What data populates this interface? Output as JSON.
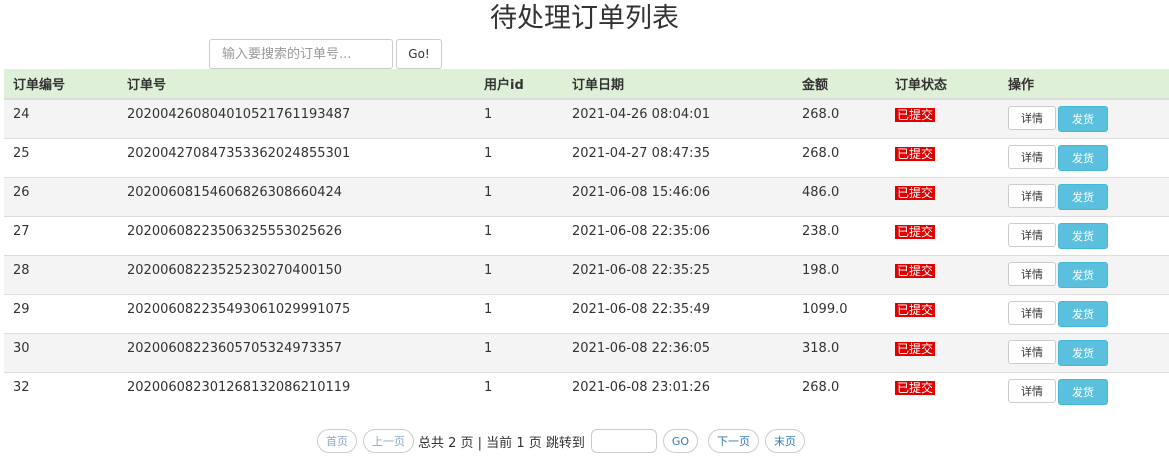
{
  "title": "待处理订单列表",
  "search": {
    "placeholder": "输入要搜索的订单号...",
    "button_label": "Go!"
  },
  "table": {
    "headers": [
      "订单编号",
      "订单号",
      "用户id",
      "订单日期",
      "金额",
      "订单状态",
      "操作"
    ],
    "rows": [
      {
        "id": "24",
        "order_no": "20200426080401052176119348​7",
        "user_id": "1",
        "date": "2021-04-26 08:04:01",
        "amount": "268.0",
        "status": "已提交"
      },
      {
        "id": "25",
        "order_no": "20200427084735336202485530​1",
        "user_id": "1",
        "date": "2021-04-27 08:47:35",
        "amount": "268.0",
        "status": "已提交"
      },
      {
        "id": "26",
        "order_no": "202006081546068263086604​24",
        "user_id": "1",
        "date": "2021-06-08 15:46:06",
        "amount": "486.0",
        "status": "已提交"
      },
      {
        "id": "27",
        "order_no": "202006082235063255530256​26",
        "user_id": "1",
        "date": "2021-06-08 22:35:06",
        "amount": "238.0",
        "status": "已提交"
      },
      {
        "id": "28",
        "order_no": "202006082235252302704001​50",
        "user_id": "1",
        "date": "2021-06-08 22:35:25",
        "amount": "198.0",
        "status": "已提交"
      },
      {
        "id": "29",
        "order_no": "202006082235493061029991​075",
        "user_id": "1",
        "date": "2021-06-08 22:35:49",
        "amount": "1099.0",
        "status": "已提交"
      },
      {
        "id": "30",
        "order_no": "202006082236057053249733​57",
        "user_id": "1",
        "date": "2021-06-08 22:36:05",
        "amount": "318.0",
        "status": "已提交"
      },
      {
        "id": "32",
        "order_no": "202006082301268132086210​119",
        "user_id": "1",
        "date": "2021-06-08 23:01:26",
        "amount": "268.0",
        "status": "已提交"
      }
    ],
    "detail_label": "详情",
    "ship_label": "发货"
  },
  "pager": {
    "first": "首页",
    "prev": "上一页",
    "info": "总共 2 页 | 当前 1 页 跳转到",
    "go": "GO",
    "next": "下一页",
    "last": "末页"
  },
  "colors": {
    "header_bg": "#dff0d8",
    "status_badge": "#e00000",
    "ship_button": "#5bc0de"
  }
}
